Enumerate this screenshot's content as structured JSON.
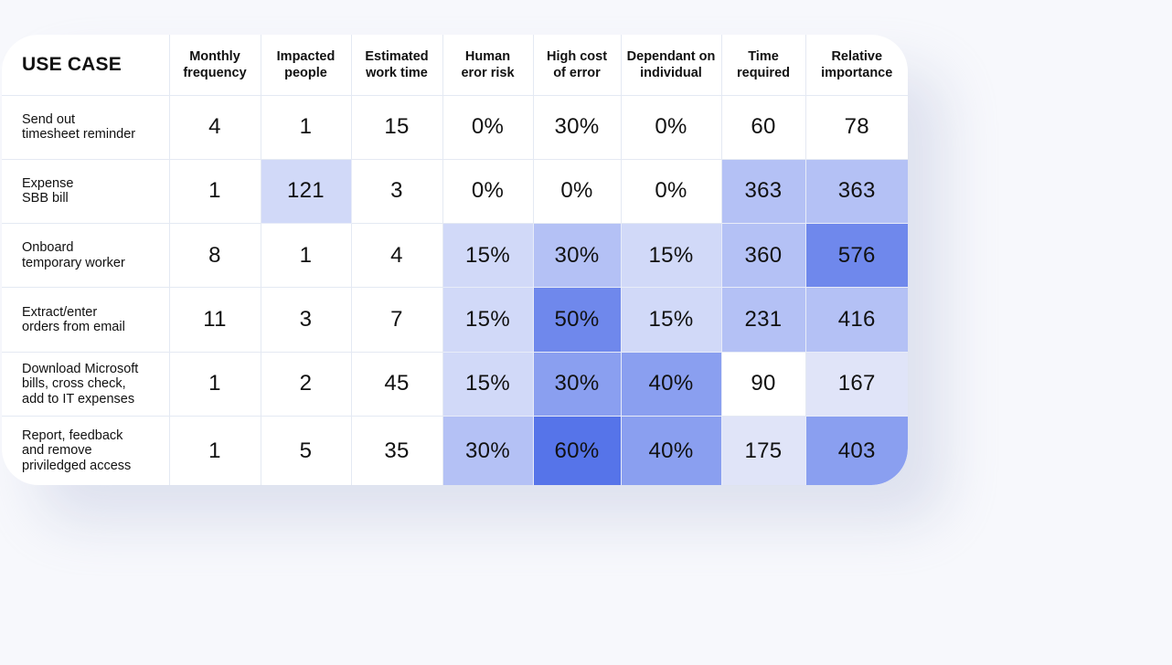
{
  "chart_data": {
    "type": "heatmap",
    "title": "USE CASE",
    "columns": [
      "Monthly frequency",
      "Impacted people",
      "Estimated work time",
      "Human eror risk",
      "High cost of error",
      "Dependant on individual",
      "Time required",
      "Relative importance"
    ],
    "rows": [
      {
        "label": "Send out\ntimesheet reminder",
        "values": [
          "4",
          "1",
          "15",
          "0%",
          "30%",
          "0%",
          "60",
          "78"
        ],
        "levels": [
          0,
          0,
          0,
          0,
          0,
          0,
          0,
          0
        ]
      },
      {
        "label": "Expense\nSBB bill",
        "values": [
          "1",
          "121",
          "3",
          "0%",
          "0%",
          "0%",
          "363",
          "363"
        ],
        "levels": [
          0,
          2,
          0,
          0,
          0,
          0,
          3,
          3
        ]
      },
      {
        "label": "Onboard\ntemporary worker",
        "values": [
          "8",
          "1",
          "4",
          "15%",
          "30%",
          "15%",
          "360",
          "576"
        ],
        "levels": [
          0,
          0,
          0,
          2,
          3,
          2,
          3,
          5
        ]
      },
      {
        "label": "Extract/enter\norders from email",
        "values": [
          "11",
          "3",
          "7",
          "15%",
          "50%",
          "15%",
          "231",
          "416"
        ],
        "levels": [
          0,
          0,
          0,
          2,
          5,
          2,
          3,
          3
        ]
      },
      {
        "label": "Download Microsoft\nbills, cross check,\nadd to IT expenses",
        "values": [
          "1",
          "2",
          "45",
          "15%",
          "30%",
          "40%",
          "90",
          "167"
        ],
        "levels": [
          0,
          0,
          0,
          2,
          4,
          4,
          0,
          1
        ]
      },
      {
        "label": "Report, feedback\nand remove\npriviledged access",
        "values": [
          "1",
          "5",
          "35",
          "30%",
          "60%",
          "40%",
          "175",
          "403"
        ],
        "levels": [
          0,
          0,
          0,
          3,
          6,
          4,
          1,
          4
        ]
      }
    ],
    "level_colors": [
      "#ffffff",
      "#e0e4f8",
      "#d1d9f8",
      "#b4c1f5",
      "#8a9ff0",
      "#6f88ec",
      "#5674e9"
    ]
  }
}
